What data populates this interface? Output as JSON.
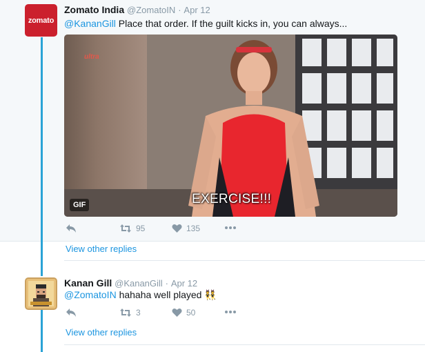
{
  "tweets": [
    {
      "avatar_text": "zomato",
      "author_name": "Zomato India",
      "author_handle": "@ZomatoIN",
      "separator": "·",
      "date": "Apr 12",
      "mention": "@KananGill",
      "text": " Place that order. If the guilt kicks in, you can always...",
      "media": {
        "type": "gif",
        "badge": "GIF",
        "watermark": "ultra",
        "caption": "EXERCISE!!!"
      },
      "retweet_count": "95",
      "like_count": "135",
      "view_replies": "View other replies"
    },
    {
      "author_name": "Kanan Gill",
      "author_handle": "@KananGill",
      "separator": "·",
      "date": "Apr 12",
      "mention": "@ZomatoIN",
      "text": " hahaha well played ",
      "emoji": "👯",
      "retweet_count": "3",
      "like_count": "50",
      "view_replies": "View other replies"
    }
  ],
  "icons": {
    "reply": "reply-icon",
    "retweet": "retweet-icon",
    "like": "heart-icon",
    "more": "more-icon"
  },
  "colors": {
    "brand_zomato": "#cb202d",
    "link": "#1b95e0",
    "thread_line": "#2aa3d6",
    "muted": "#8899a6"
  }
}
